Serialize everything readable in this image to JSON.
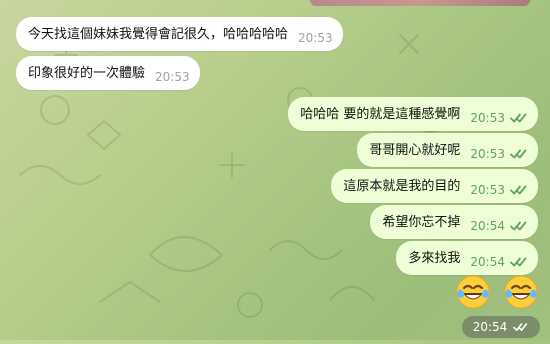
{
  "colors": {
    "incoming_bubble": "#ffffff",
    "outgoing_bubble": "#eefed6",
    "incoming_time": "#9aa6a9",
    "outgoing_time": "#5ea55b",
    "check": "#5ea55b"
  },
  "messages": [
    {
      "direction": "in",
      "text": "今天找這個妹妹我覺得會記很久，哈哈哈哈哈",
      "time": "20:53"
    },
    {
      "direction": "in",
      "text": "印象很好的一次體驗",
      "time": "20:53"
    },
    {
      "direction": "out",
      "text": "哈哈哈  要的就是這種感覺啊",
      "time": "20:53",
      "status_icon": "double-check-icon"
    },
    {
      "direction": "out",
      "text": "哥哥開心就好呢",
      "time": "20:53",
      "status_icon": "double-check-icon"
    },
    {
      "direction": "out",
      "text": "這原本就是我的目的",
      "time": "20:53",
      "status_icon": "double-check-icon"
    },
    {
      "direction": "out",
      "text": "希望你忘不掉",
      "time": "20:54",
      "status_icon": "double-check-icon"
    },
    {
      "direction": "out",
      "text": "多來找我",
      "time": "20:54",
      "status_icon": "double-check-icon"
    }
  ],
  "emoji_message": {
    "emojis": [
      "tears-of-joy-emoji",
      "tears-of-joy-emoji"
    ],
    "time": "20:54",
    "status_icon": "double-check-icon"
  }
}
